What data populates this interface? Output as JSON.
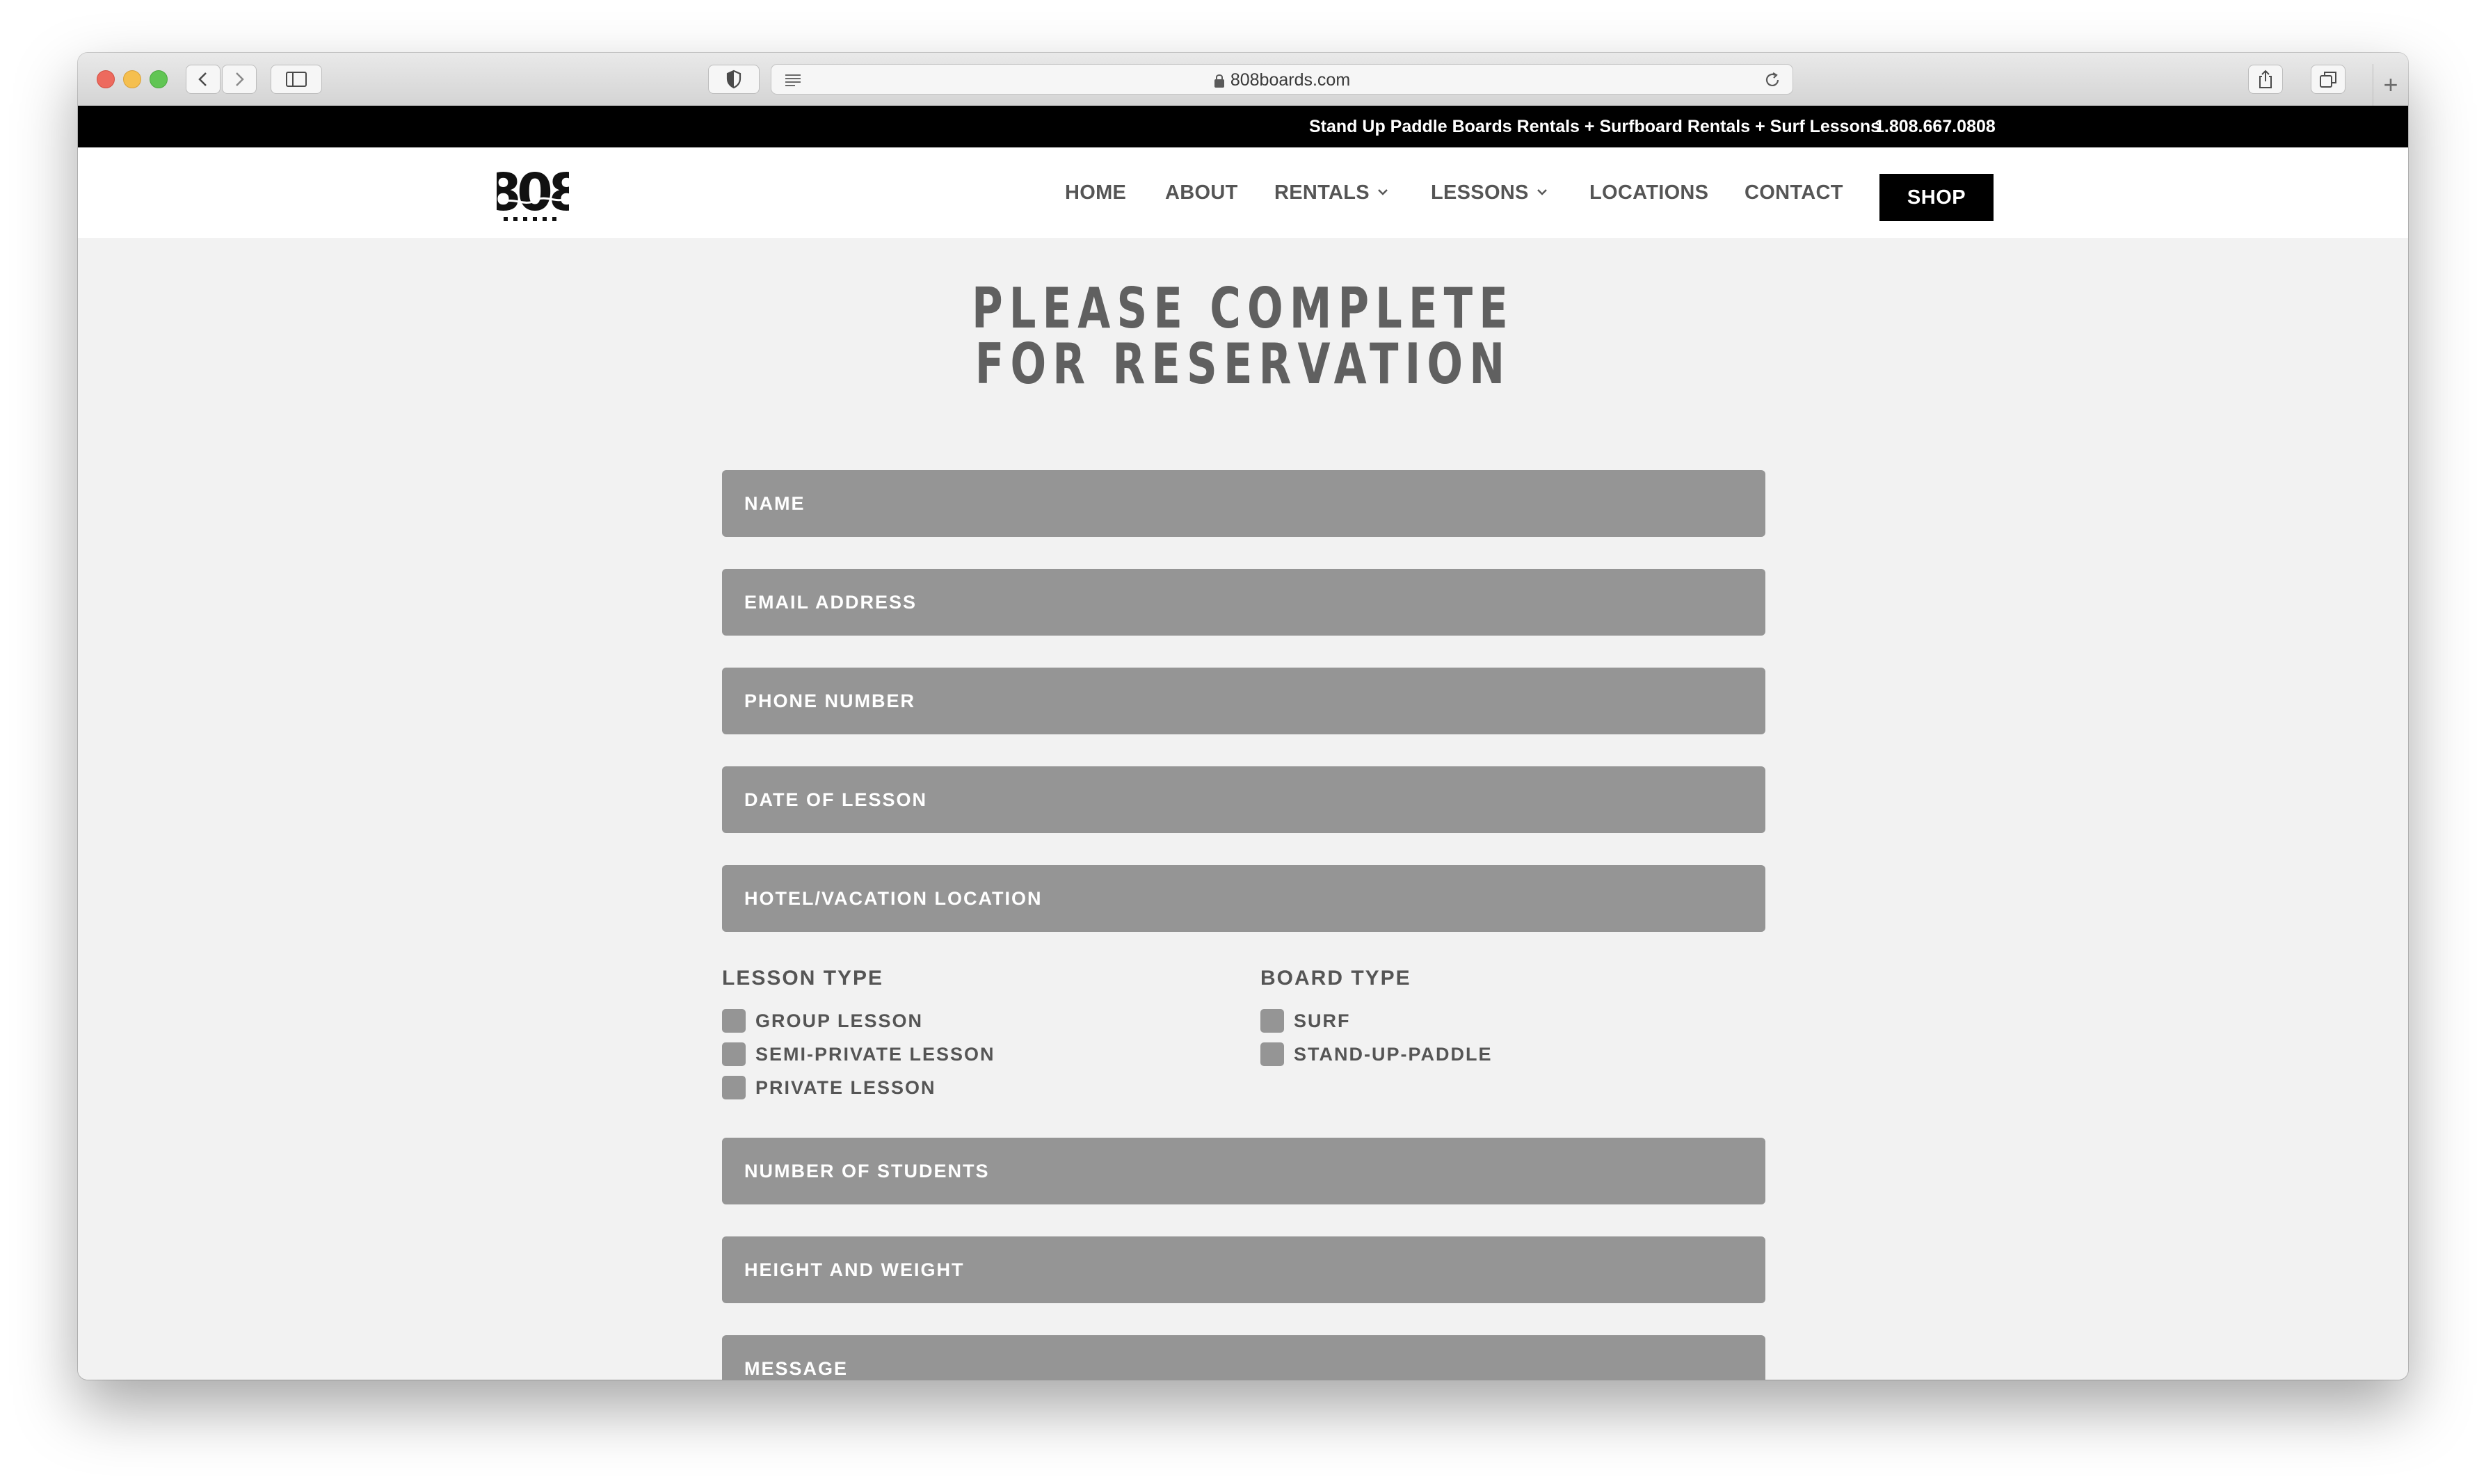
{
  "browser": {
    "url": "808boards.com"
  },
  "site": {
    "topbar": {
      "tagline": "Stand Up Paddle Boards Rentals + Surfboard Rentals + Surf Lessons",
      "phone": "1.808.667.0808"
    },
    "logo_text": "808",
    "nav": {
      "home": "HOME",
      "about": "ABOUT",
      "rentals": "RENTALS",
      "lessons": "LESSONS",
      "locations": "LOCATIONS",
      "contact": "CONTACT",
      "shop": "SHOP"
    }
  },
  "form": {
    "title_line1": "PLEASE COMPLETE",
    "title_line2": "FOR RESERVATION",
    "fields": {
      "name": "NAME",
      "email": "EMAIL ADDRESS",
      "phone": "PHONE NUMBER",
      "date": "DATE OF LESSON",
      "hotel": "HOTEL/VACATION LOCATION",
      "students": "NUMBER OF STUDENTS",
      "height_weight": "HEIGHT AND WEIGHT",
      "message": "MESSAGE"
    },
    "lesson_type": {
      "label": "LESSON TYPE",
      "options": [
        "GROUP LESSON",
        "SEMI-PRIVATE LESSON",
        "PRIVATE LESSON"
      ]
    },
    "board_type": {
      "label": "BOARD TYPE",
      "options": [
        "SURF",
        "STAND-UP-PADDLE"
      ]
    }
  },
  "colors": {
    "field_bg": "#959595",
    "page_bg": "#f2f2f2",
    "topbar_bg": "#000000",
    "text_gray": "#555555"
  }
}
